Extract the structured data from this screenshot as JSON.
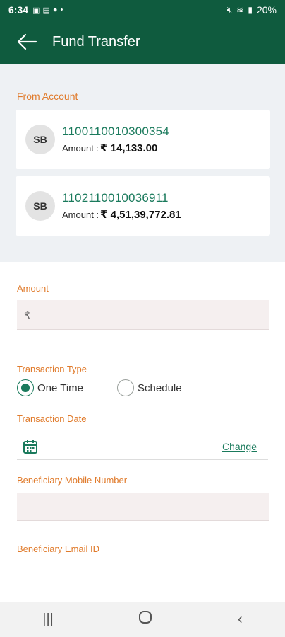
{
  "status_bar": {
    "time": "6:34",
    "battery": "20%"
  },
  "app_bar": {
    "title": "Fund Transfer"
  },
  "from_account": {
    "label": "From Account",
    "accounts": [
      {
        "type": "SB",
        "number": "1100110010300354",
        "amount_label": "Amount :",
        "amount": "₹ 14,133.00"
      },
      {
        "type": "SB",
        "number": "1102110010036911",
        "amount_label": "Amount :",
        "amount": "₹ 4,51,39,772.81"
      }
    ]
  },
  "amount": {
    "label": "Amount",
    "prefix": "₹",
    "value": ""
  },
  "transaction_type": {
    "label": "Transaction Type",
    "options": [
      {
        "label": "One Time",
        "selected": true
      },
      {
        "label": "Schedule",
        "selected": false
      }
    ]
  },
  "transaction_date": {
    "label": "Transaction Date",
    "change": "Change",
    "value": ""
  },
  "beneficiary_mobile": {
    "label": "Beneficiary Mobile Number",
    "value": ""
  },
  "beneficiary_email": {
    "label": "Beneficiary Email ID",
    "value": ""
  },
  "colors": {
    "primary": "#0f5b3e",
    "accent": "#e07b2c",
    "link": "#1a7a5c"
  },
  "nav": {
    "recents": "recents-icon",
    "home": "home-icon",
    "back": "back-icon"
  }
}
